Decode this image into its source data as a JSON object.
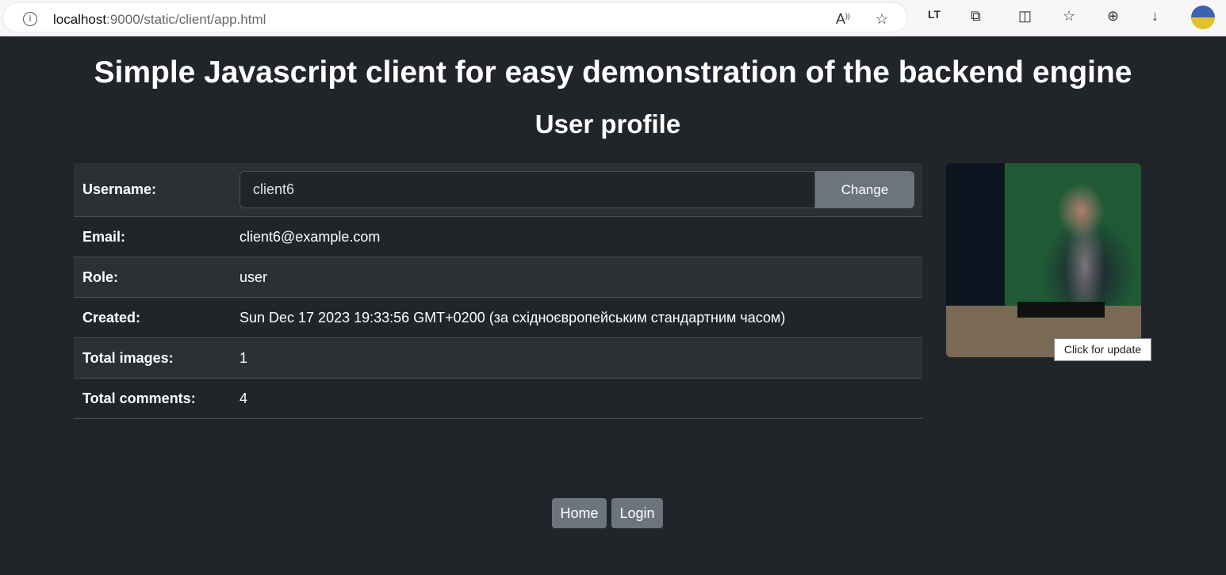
{
  "browser": {
    "url_host": "localhost",
    "url_path": ":9000/static/client/app.html"
  },
  "header": {
    "title": "Simple Javascript client for easy demonstration of the backend engine",
    "subtitle": "User profile"
  },
  "profile": {
    "username_label": "Username:",
    "username_value": "client6",
    "change_label": "Change",
    "rows": [
      {
        "label": "Email:",
        "value": "client6@example.com"
      },
      {
        "label": "Role:",
        "value": "user"
      },
      {
        "label": "Created:",
        "value": "Sun Dec 17 2023 19:33:56 GMT+0200 (за східноєвропейським стандартним часом)"
      },
      {
        "label": "Total images:",
        "value": "1"
      },
      {
        "label": "Total comments:",
        "value": "4"
      }
    ]
  },
  "avatar": {
    "tooltip": "Click for update"
  },
  "nav": {
    "home": "Home",
    "login": "Login"
  }
}
